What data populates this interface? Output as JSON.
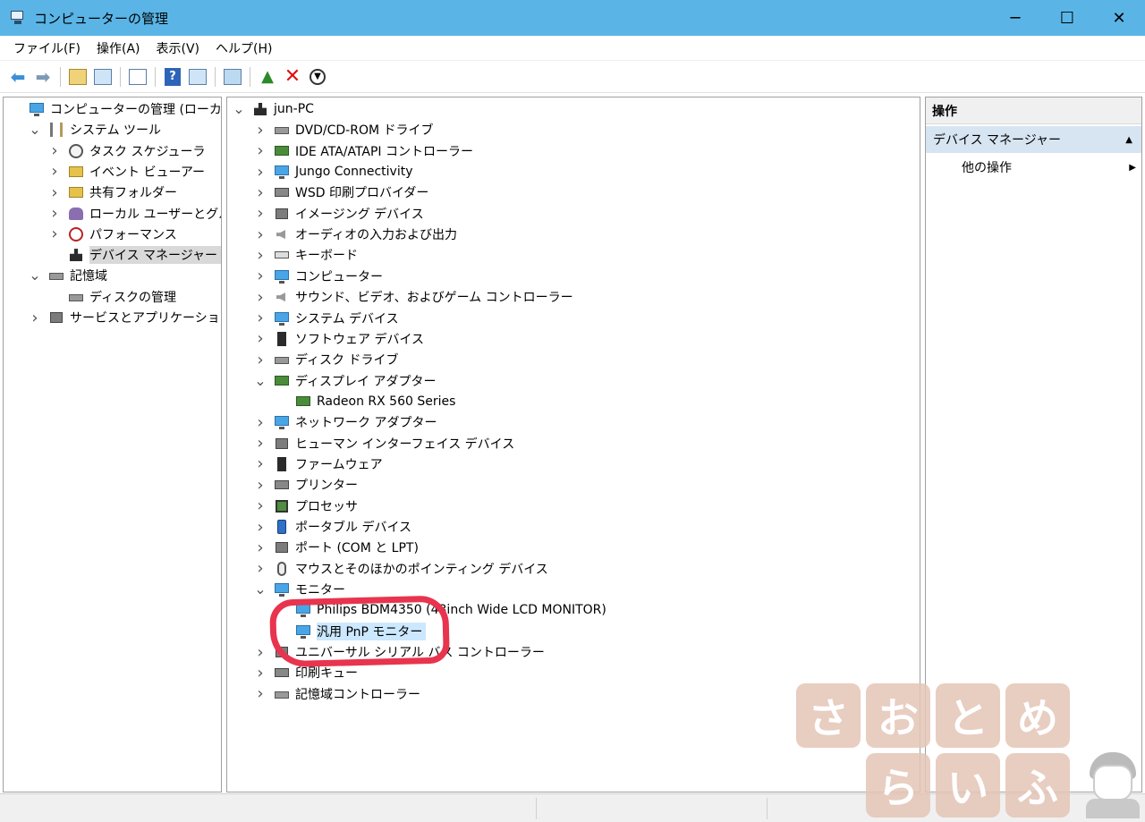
{
  "window": {
    "title": "コンピューターの管理",
    "minimize": "─",
    "maximize": "☐",
    "close": "✕"
  },
  "menu": [
    "ファイル(F)",
    "操作(A)",
    "表示(V)",
    "ヘルプ(H)"
  ],
  "toolbar": {
    "back_icon": "back-arrow-icon",
    "forward_icon": "forward-arrow-icon",
    "help_label": "?"
  },
  "left_tree": [
    {
      "label": "コンピューターの管理 (ローカル)",
      "level": 0,
      "expander": "",
      "icon": "computer-management-icon"
    },
    {
      "label": "システム ツール",
      "level": 1,
      "expander": "v",
      "icon": "system-tools-icon"
    },
    {
      "label": "タスク スケジューラ",
      "level": 2,
      "expander": ">",
      "icon": "task-scheduler-icon"
    },
    {
      "label": "イベント ビューアー",
      "level": 2,
      "expander": ">",
      "icon": "event-viewer-icon"
    },
    {
      "label": "共有フォルダー",
      "level": 2,
      "expander": ">",
      "icon": "shared-folders-icon"
    },
    {
      "label": "ローカル ユーザーとグループ",
      "level": 2,
      "expander": ">",
      "icon": "local-users-icon"
    },
    {
      "label": "パフォーマンス",
      "level": 2,
      "expander": ">",
      "icon": "performance-icon"
    },
    {
      "label": "デバイス マネージャー",
      "level": 2,
      "expander": "",
      "icon": "device-manager-icon",
      "selected": true
    },
    {
      "label": "記憶域",
      "level": 1,
      "expander": "v",
      "icon": "storage-icon"
    },
    {
      "label": "ディスクの管理",
      "level": 2,
      "expander": "",
      "icon": "disk-management-icon"
    },
    {
      "label": "サービスとアプリケーション",
      "level": 1,
      "expander": ">",
      "icon": "services-icon"
    }
  ],
  "device_tree": [
    {
      "label": "jun-PC",
      "level": 0,
      "expander": "v",
      "icon": "computer-root-icon"
    },
    {
      "label": "DVD/CD-ROM ドライブ",
      "level": 1,
      "expander": ">",
      "icon": "dvd-drive-icon"
    },
    {
      "label": "IDE ATA/ATAPI コントローラー",
      "level": 1,
      "expander": ">",
      "icon": "ide-controller-icon"
    },
    {
      "label": "Jungo Connectivity",
      "level": 1,
      "expander": ">",
      "icon": "jungo-icon"
    },
    {
      "label": "WSD 印刷プロバイダー",
      "level": 1,
      "expander": ">",
      "icon": "wsd-printer-icon"
    },
    {
      "label": "イメージング デバイス",
      "level": 1,
      "expander": ">",
      "icon": "imaging-device-icon"
    },
    {
      "label": "オーディオの入力および出力",
      "level": 1,
      "expander": ">",
      "icon": "audio-io-icon"
    },
    {
      "label": "キーボード",
      "level": 1,
      "expander": ">",
      "icon": "keyboard-icon"
    },
    {
      "label": "コンピューター",
      "level": 1,
      "expander": ">",
      "icon": "computer-icon"
    },
    {
      "label": "サウンド、ビデオ、およびゲーム コントローラー",
      "level": 1,
      "expander": ">",
      "icon": "sound-icon"
    },
    {
      "label": "システム デバイス",
      "level": 1,
      "expander": ">",
      "icon": "system-device-icon"
    },
    {
      "label": "ソフトウェア デバイス",
      "level": 1,
      "expander": ">",
      "icon": "software-device-icon"
    },
    {
      "label": "ディスク ドライブ",
      "level": 1,
      "expander": ">",
      "icon": "disk-drive-icon"
    },
    {
      "label": "ディスプレイ アダプター",
      "level": 1,
      "expander": "v",
      "icon": "display-adapter-icon"
    },
    {
      "label": "Radeon RX 560 Series",
      "level": 2,
      "expander": "",
      "icon": "display-adapter-icon"
    },
    {
      "label": "ネットワーク アダプター",
      "level": 1,
      "expander": ">",
      "icon": "network-adapter-icon"
    },
    {
      "label": "ヒューマン インターフェイス デバイス",
      "level": 1,
      "expander": ">",
      "icon": "hid-icon"
    },
    {
      "label": "ファームウェア",
      "level": 1,
      "expander": ">",
      "icon": "firmware-icon"
    },
    {
      "label": "プリンター",
      "level": 1,
      "expander": ">",
      "icon": "printer-icon"
    },
    {
      "label": "プロセッサ",
      "level": 1,
      "expander": ">",
      "icon": "processor-icon"
    },
    {
      "label": "ポータブル デバイス",
      "level": 1,
      "expander": ">",
      "icon": "portable-device-icon"
    },
    {
      "label": "ポート (COM と LPT)",
      "level": 1,
      "expander": ">",
      "icon": "port-icon"
    },
    {
      "label": "マウスとそのほかのポインティング デバイス",
      "level": 1,
      "expander": ">",
      "icon": "mouse-icon"
    },
    {
      "label": "モニター",
      "level": 1,
      "expander": "v",
      "icon": "monitor-icon"
    },
    {
      "label": "Philips BDM4350 (43inch Wide LCD MONITOR)",
      "level": 2,
      "expander": "",
      "icon": "monitor-icon"
    },
    {
      "label": "汎用 PnP モニター",
      "level": 2,
      "expander": "",
      "icon": "monitor-icon",
      "selected": true
    },
    {
      "label": "ユニバーサル シリアル バス コントローラー",
      "level": 1,
      "expander": ">",
      "icon": "usb-controller-icon"
    },
    {
      "label": "印刷キュー",
      "level": 1,
      "expander": ">",
      "icon": "print-queue-icon"
    },
    {
      "label": "記憶域コントローラー",
      "level": 1,
      "expander": ">",
      "icon": "storage-controller-icon"
    }
  ],
  "actions": {
    "header": "操作",
    "section": "デバイス マネージャー",
    "section_arrow": "▲",
    "item": "他の操作",
    "item_arrow": "▶"
  },
  "watermark": {
    "row1": [
      "さ",
      "お",
      "と",
      "め"
    ],
    "row2": [
      "ら",
      "い",
      "ふ"
    ]
  },
  "colors": {
    "titlebar": "#5ab5e6",
    "annotation": "#e8344e",
    "selection": "#cce8ff"
  }
}
